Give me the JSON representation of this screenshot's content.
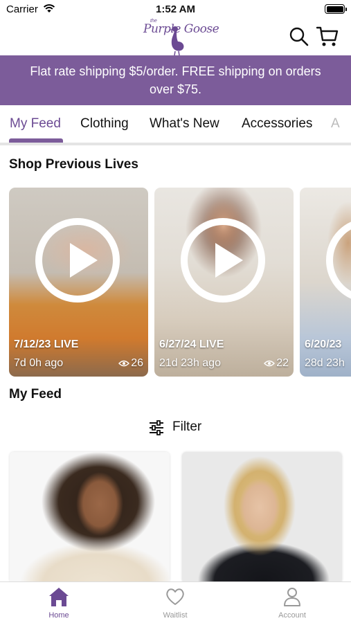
{
  "status_bar": {
    "carrier": "Carrier",
    "time": "1:52 AM"
  },
  "header": {
    "logo_text": "Purple Goose",
    "logo_small": "the",
    "icons": [
      "search-icon",
      "cart-icon"
    ]
  },
  "banner": {
    "line1": "Flat rate shipping $5/order. FREE shipping on orders",
    "line2": "over $75."
  },
  "tabs": [
    {
      "label": "My Feed",
      "active": true
    },
    {
      "label": "Clothing"
    },
    {
      "label": "What's New"
    },
    {
      "label": "Accessories"
    },
    {
      "label": "A"
    }
  ],
  "lives_section": {
    "title": "Shop Previous Lives",
    "items": [
      {
        "date": "7/12/23 LIVE",
        "ago": "7d 0h ago",
        "views": "26"
      },
      {
        "date": "6/27/24 LIVE",
        "ago": "21d 23h ago",
        "views": "22"
      },
      {
        "date": "6/20/23",
        "ago": "28d 23h",
        "views": ""
      }
    ]
  },
  "feed_section": {
    "title": "My Feed",
    "filter_label": "Filter"
  },
  "bottom_nav": [
    {
      "label": "Home",
      "icon": "home-icon",
      "active": true
    },
    {
      "label": "Waitlist",
      "icon": "heart-icon"
    },
    {
      "label": "Account",
      "icon": "account-icon"
    }
  ],
  "colors": {
    "brand": "#7c5c9a",
    "brand_text": "#6b4a93",
    "inactive": "#999999"
  }
}
